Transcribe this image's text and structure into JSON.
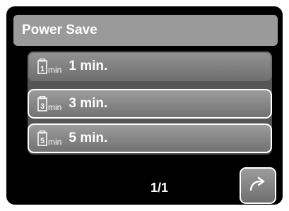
{
  "colors": {
    "background": "#000000",
    "title_bar": "#9a9a9a",
    "item": "#808080",
    "text": "#ffffff"
  },
  "header": {
    "title": "Power Save"
  },
  "menu": {
    "items": [
      {
        "icon": "battery-timer-icon",
        "icon_digit": "1",
        "icon_unit": "min",
        "label": "1 min.",
        "selected": true
      },
      {
        "icon": "battery-timer-icon",
        "icon_digit": "3",
        "icon_unit": "min",
        "label": "3 min.",
        "selected": false
      },
      {
        "icon": "battery-timer-icon",
        "icon_digit": "5",
        "icon_unit": "min",
        "label": "5 min.",
        "selected": false
      }
    ]
  },
  "footer": {
    "page": "1/1",
    "next_icon": "forward-arrow-icon"
  }
}
